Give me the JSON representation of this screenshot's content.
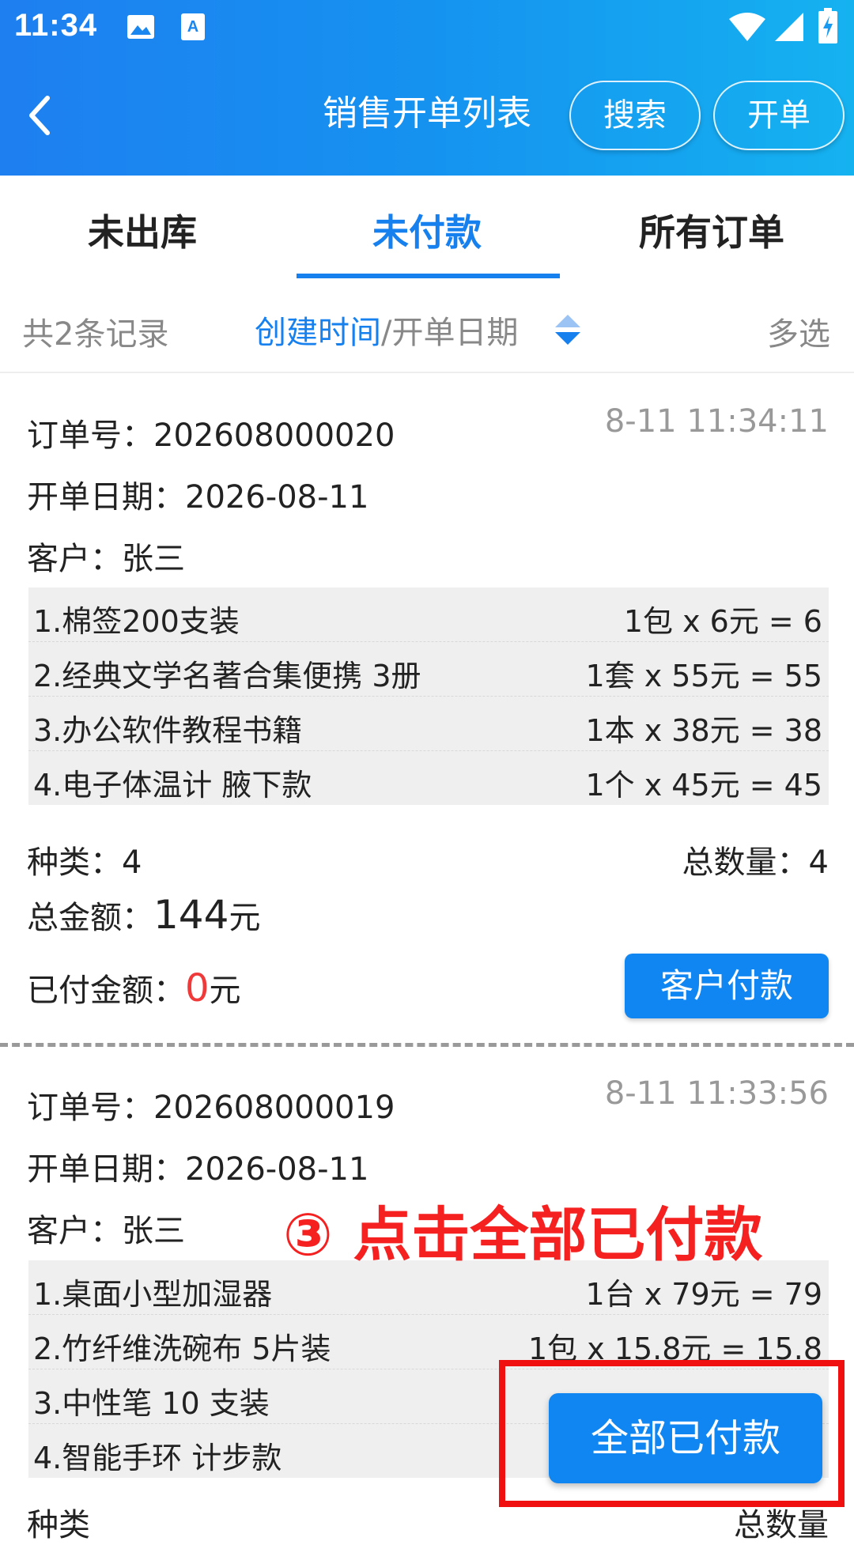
{
  "status_bar": {
    "time": "11:34"
  },
  "header": {
    "title": "销售开单列表",
    "search_label": "搜索",
    "open_label": "开单"
  },
  "tabs": [
    {
      "label": "未出库"
    },
    {
      "label": "未付款"
    },
    {
      "label": "所有订单"
    }
  ],
  "filter": {
    "count": "共2条记录",
    "sort_active": "创建时间",
    "sort_sep": "/开单日期",
    "multi_select": "多选"
  },
  "orders": [
    {
      "order_no": "订单号：202608000020",
      "time": "8-11 11:34:11",
      "date": "开单日期：2026-08-11",
      "customer": "客户：张三",
      "items": [
        {
          "name": "1.棉签200支装",
          "price": "1包 x 6元 = 6"
        },
        {
          "name": "2.经典文学名著合集便携 3册",
          "price": "1套 x 55元 = 55"
        },
        {
          "name": "3.办公软件教程书籍",
          "price": "1本 x 38元 = 38"
        },
        {
          "name": "4.电子体温计 腋下款",
          "price": "1个 x 45元 = 45"
        }
      ],
      "kinds": "种类：4",
      "total_qty": "总数量：4",
      "total_amount_label": "总金额：",
      "total_amount_value": "144",
      "total_amount_unit": "元",
      "paid_label": "已付金额：",
      "paid_value": "0",
      "paid_unit": "元",
      "pay_button": "客户付款"
    },
    {
      "order_no": "订单号：202608000019",
      "time": "8-11 11:33:56",
      "date": "开单日期：2026-08-11",
      "customer": "客户：张三",
      "items": [
        {
          "name": "1.桌面小型加湿器",
          "price": "1台 x 79元 = 79"
        },
        {
          "name": "2.竹纤维洗碗布 5片装",
          "price": "1包 x 15.8元 = 15.8"
        },
        {
          "name": "3.中性笔 10 支装",
          "price": ""
        },
        {
          "name": "4.智能手环 计步款",
          "price": ""
        }
      ],
      "kinds": "种类",
      "total_qty": "总数量"
    }
  ],
  "annotation": "③ 点击全部已付款",
  "all_paid_button": "全部已付款"
}
